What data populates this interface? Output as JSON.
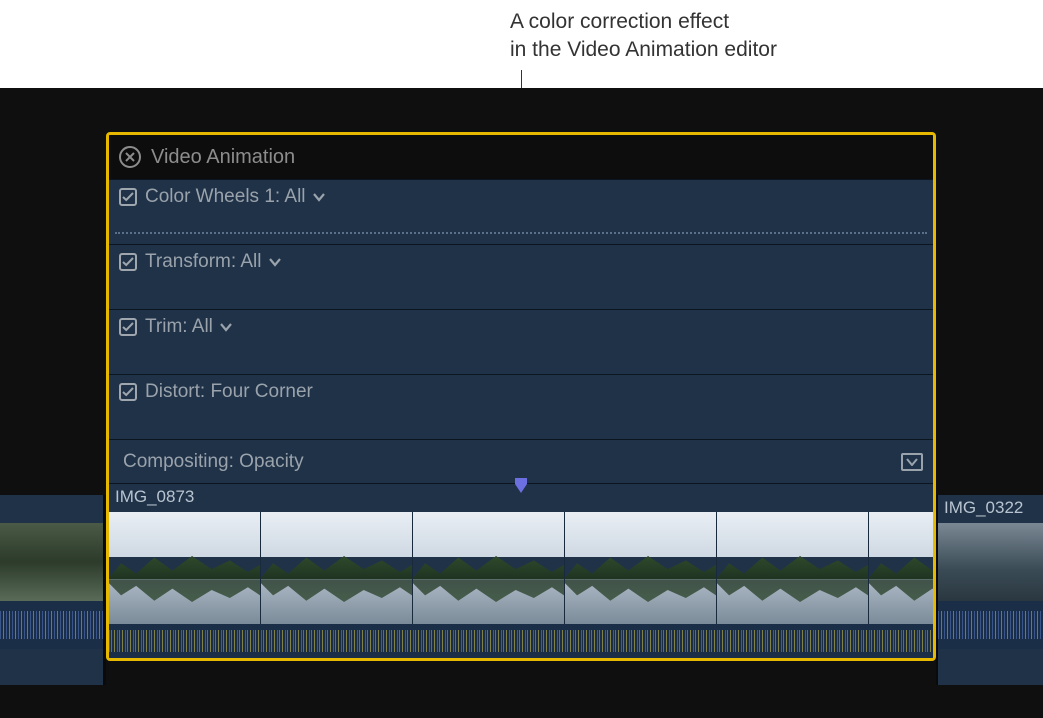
{
  "annotation": {
    "line1": "A color correction effect",
    "line2": "in the Video Animation editor"
  },
  "editor": {
    "title": "Video Animation",
    "rows": [
      {
        "label": "Color Wheels 1: All",
        "has_checkbox": true,
        "has_chevron": true,
        "dotted_track": true
      },
      {
        "label": "Transform: All",
        "has_checkbox": true,
        "has_chevron": true
      },
      {
        "label": "Trim: All",
        "has_checkbox": true,
        "has_chevron": true
      },
      {
        "label": "Distort: Four Corner",
        "has_checkbox": true,
        "has_chevron": false
      }
    ],
    "compositing_label": "Compositing: Opacity",
    "clip_name": "IMG_0873"
  },
  "neighbors": {
    "left_name": "",
    "right_name": "IMG_0322"
  },
  "colors": {
    "panel_border": "#e6b800",
    "row_bg": "#1f3248",
    "text_muted": "#9aa2ab"
  }
}
